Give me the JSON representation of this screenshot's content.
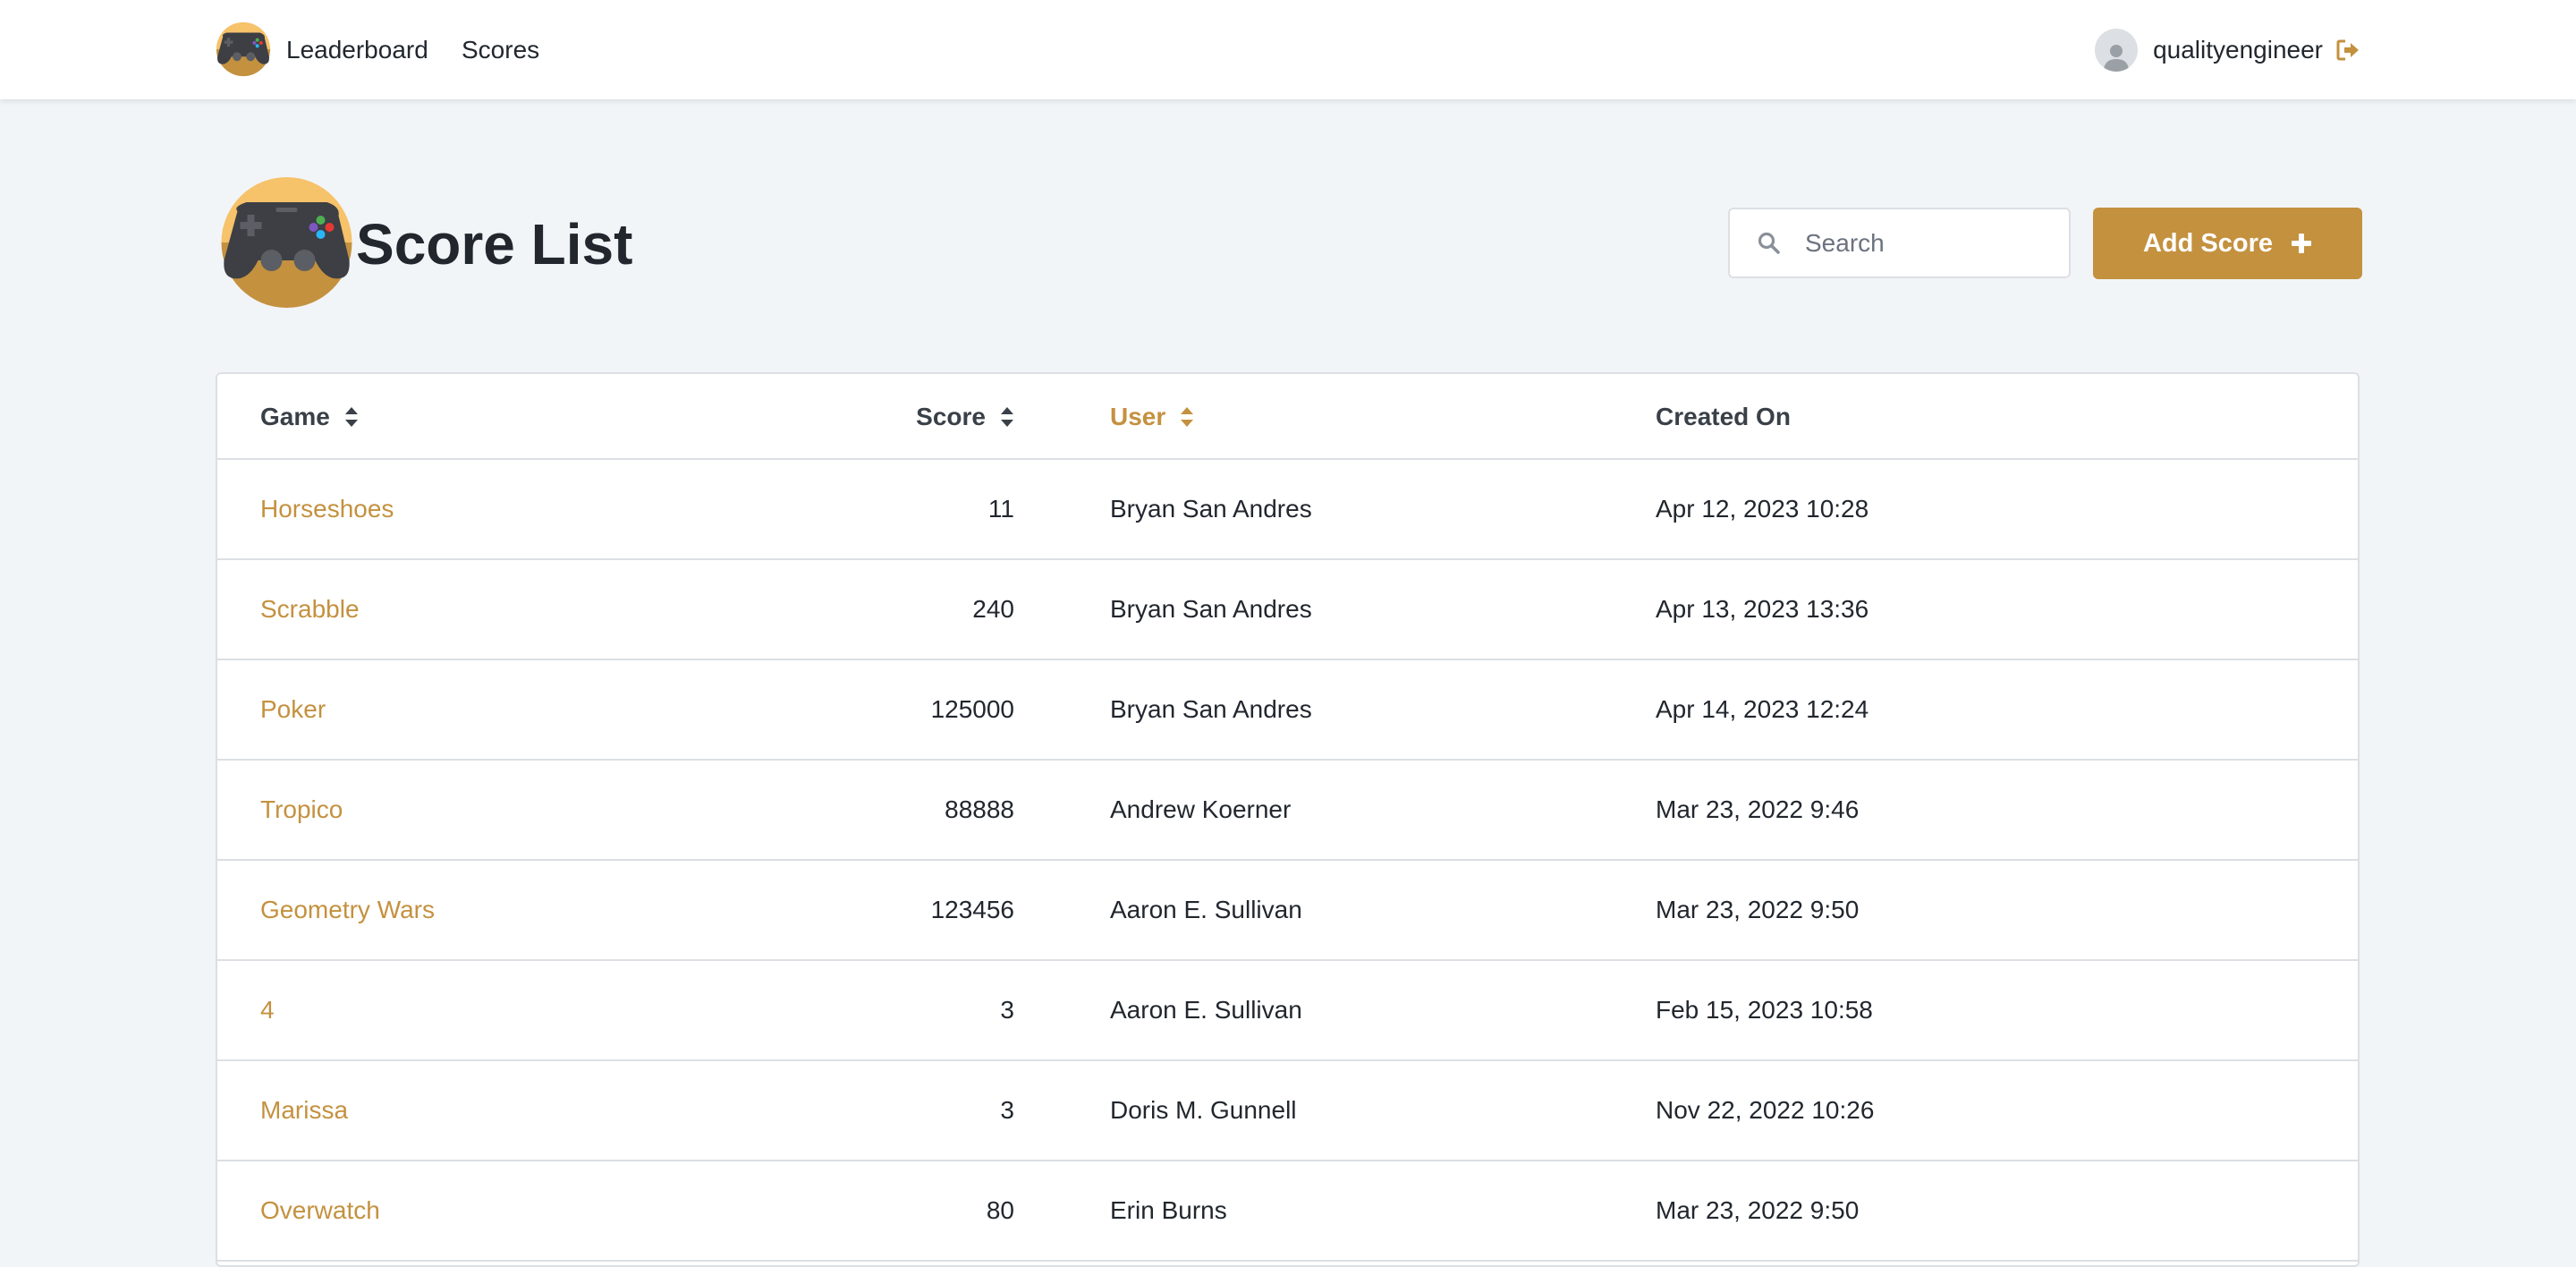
{
  "nav": {
    "logo_icon": "gamepad-logo-icon",
    "links": [
      "Leaderboard",
      "Scores"
    ],
    "username": "qualityengineer",
    "avatar_icon": "user-avatar-icon",
    "logout_icon": "sign-out-icon"
  },
  "header": {
    "title": "Score List",
    "logo_icon": "gamepad-logo-icon",
    "search_placeholder": "Search",
    "add_button_label": "Add Score",
    "add_button_icon": "plus-icon"
  },
  "colors": {
    "accent": "#c4913f",
    "logo_circle": "#f6c26a",
    "background": "#f2f5f8",
    "text": "#22272e",
    "border": "#dcdfe3"
  },
  "table": {
    "columns": [
      {
        "label": "Game",
        "sortable": true,
        "active": false
      },
      {
        "label": "Score",
        "sortable": true,
        "active": false
      },
      {
        "label": "User",
        "sortable": true,
        "active": true
      },
      {
        "label": "Created On",
        "sortable": false,
        "active": false
      }
    ],
    "rows": [
      {
        "game": "Horseshoes",
        "score": "11",
        "user": "Bryan San Andres",
        "created_on": "Apr 12, 2023 10:28"
      },
      {
        "game": "Scrabble",
        "score": "240",
        "user": "Bryan San Andres",
        "created_on": "Apr 13, 2023 13:36"
      },
      {
        "game": "Poker",
        "score": "125000",
        "user": "Bryan San Andres",
        "created_on": "Apr 14, 2023 12:24"
      },
      {
        "game": "Tropico",
        "score": "88888",
        "user": "Andrew Koerner",
        "created_on": "Mar 23, 2022 9:46"
      },
      {
        "game": "Geometry Wars",
        "score": "123456",
        "user": "Aaron E. Sullivan",
        "created_on": "Mar 23, 2022 9:50"
      },
      {
        "game": "4",
        "score": "3",
        "user": "Aaron E. Sullivan",
        "created_on": "Feb 15, 2023 10:58"
      },
      {
        "game": "Marissa",
        "score": "3",
        "user": "Doris M. Gunnell",
        "created_on": "Nov 22, 2022 10:26"
      },
      {
        "game": "Overwatch",
        "score": "80",
        "user": "Erin Burns",
        "created_on": "Mar 23, 2022 9:50"
      }
    ]
  }
}
